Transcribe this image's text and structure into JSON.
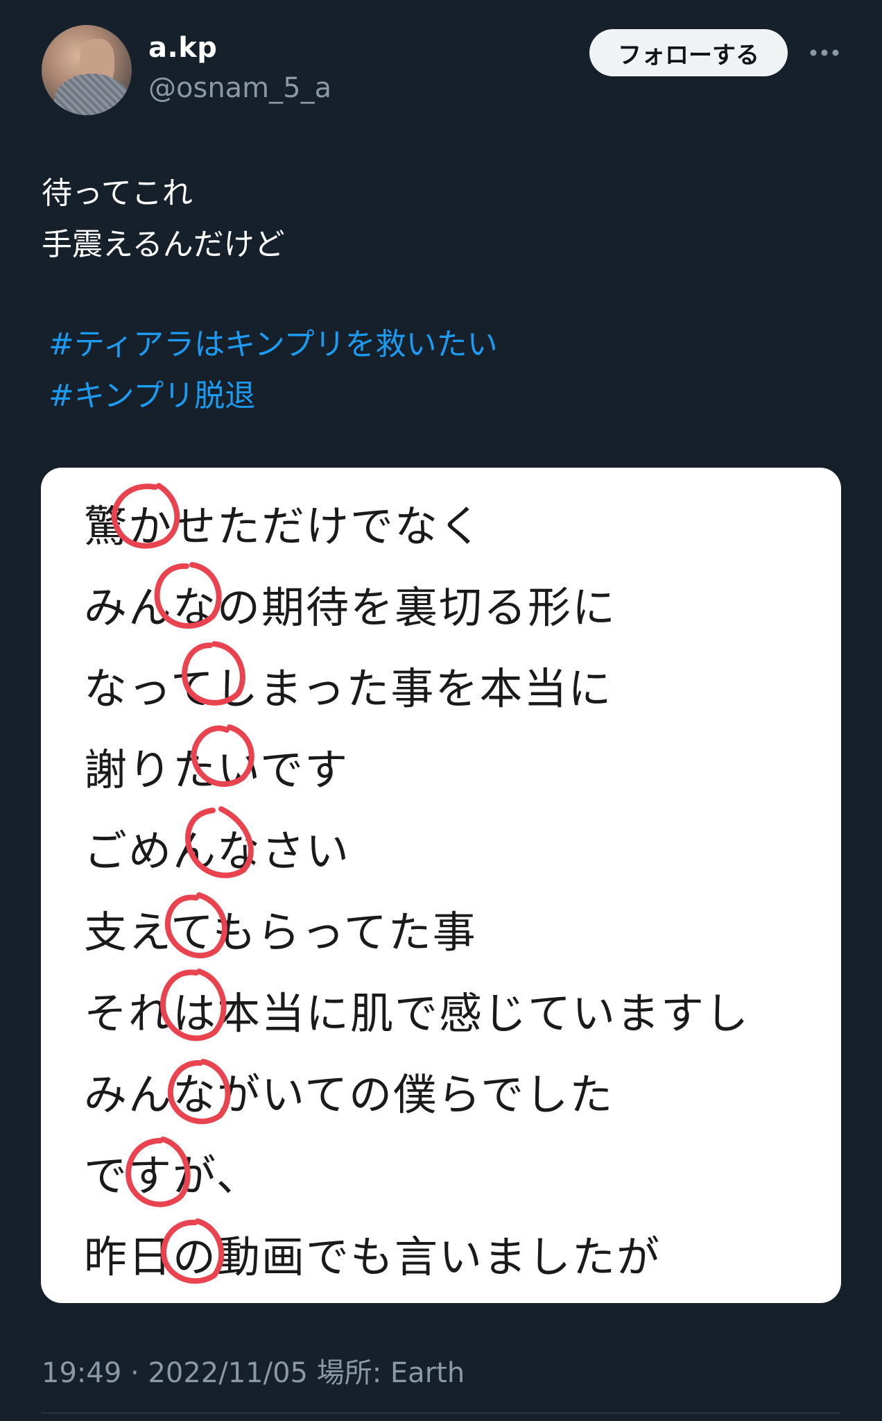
{
  "user": {
    "display_name": "a.kp",
    "handle": "@osnam_5_a"
  },
  "actions": {
    "follow_label": "フォローする",
    "more_icon": "more-horizontal-icon"
  },
  "tweet": {
    "lines": [
      "待ってこれ",
      "手震えるんだけど"
    ],
    "hashtags": [
      "#ティアラはキンプリを救いたい",
      "#キンプリ脱退"
    ]
  },
  "media": {
    "lines": [
      "驚かせただけでなく",
      "みんなの期待を裏切る形に",
      "なってしまった事を本当に",
      "謝りたいです",
      "ごめんなさい",
      "支えてもらってた事",
      "それは本当に肌で感じていますし",
      "みんながいての僕らでした",
      "ですが、",
      "昨日の動画でも言いましたが"
    ],
    "circled_characters": [
      "か",
      "な",
      "し",
      "い",
      "な",
      "て",
      "は",
      "な",
      "す",
      "の"
    ],
    "circle_color": "#e8434f"
  },
  "meta": {
    "time": "19:49",
    "separator": "·",
    "date": "2022/11/05",
    "location_label": "場所:",
    "location": "Earth"
  },
  "colors": {
    "background": "#15202b",
    "link": "#1d9bf0",
    "secondary_text": "#8b98a5"
  }
}
